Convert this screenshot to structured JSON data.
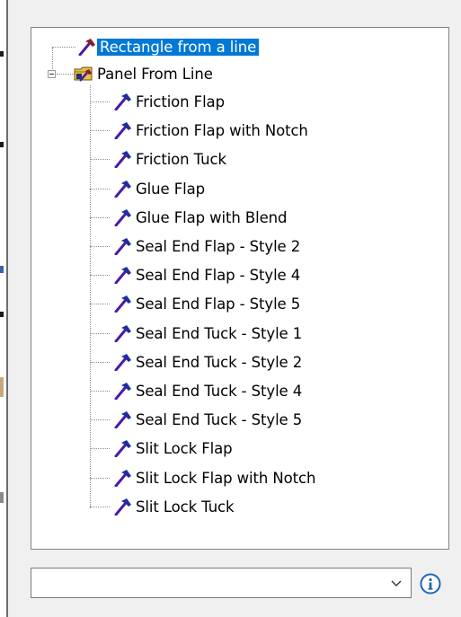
{
  "tree": {
    "root_item": {
      "label": "Rectangle from a line",
      "selected": true,
      "icon": "hammer-icon"
    },
    "folder": {
      "label": "Panel From Line",
      "expanded": true,
      "icon": "folder-icon",
      "expander_icon": "minus-box-icon",
      "items": [
        {
          "label": "Friction Flap"
        },
        {
          "label": "Friction Flap with Notch"
        },
        {
          "label": "Friction Tuck"
        },
        {
          "label": "Glue Flap"
        },
        {
          "label": "Glue Flap with Blend"
        },
        {
          "label": "Seal End Flap - Style 2"
        },
        {
          "label": "Seal End Flap - Style 4"
        },
        {
          "label": "Seal End Flap - Style 5"
        },
        {
          "label": "Seal End Tuck - Style 1"
        },
        {
          "label": "Seal End Tuck - Style 2"
        },
        {
          "label": "Seal End Tuck - Style 4"
        },
        {
          "label": "Seal End Tuck - Style 5"
        },
        {
          "label": "Slit Lock Flap"
        },
        {
          "label": "Slit Lock Flap with Notch"
        },
        {
          "label": "Slit Lock Tuck"
        }
      ]
    }
  },
  "combo": {
    "value": "",
    "arrow_icon": "chevron-down-icon"
  },
  "info_button": {
    "icon": "info-icon"
  },
  "colors": {
    "selection": "#0078d7",
    "hammer_handle": "#4b1ba8",
    "hammer_head": "#8b1a2b",
    "info_blue": "#1f66b8",
    "folder_yellow": "#e8c244"
  }
}
